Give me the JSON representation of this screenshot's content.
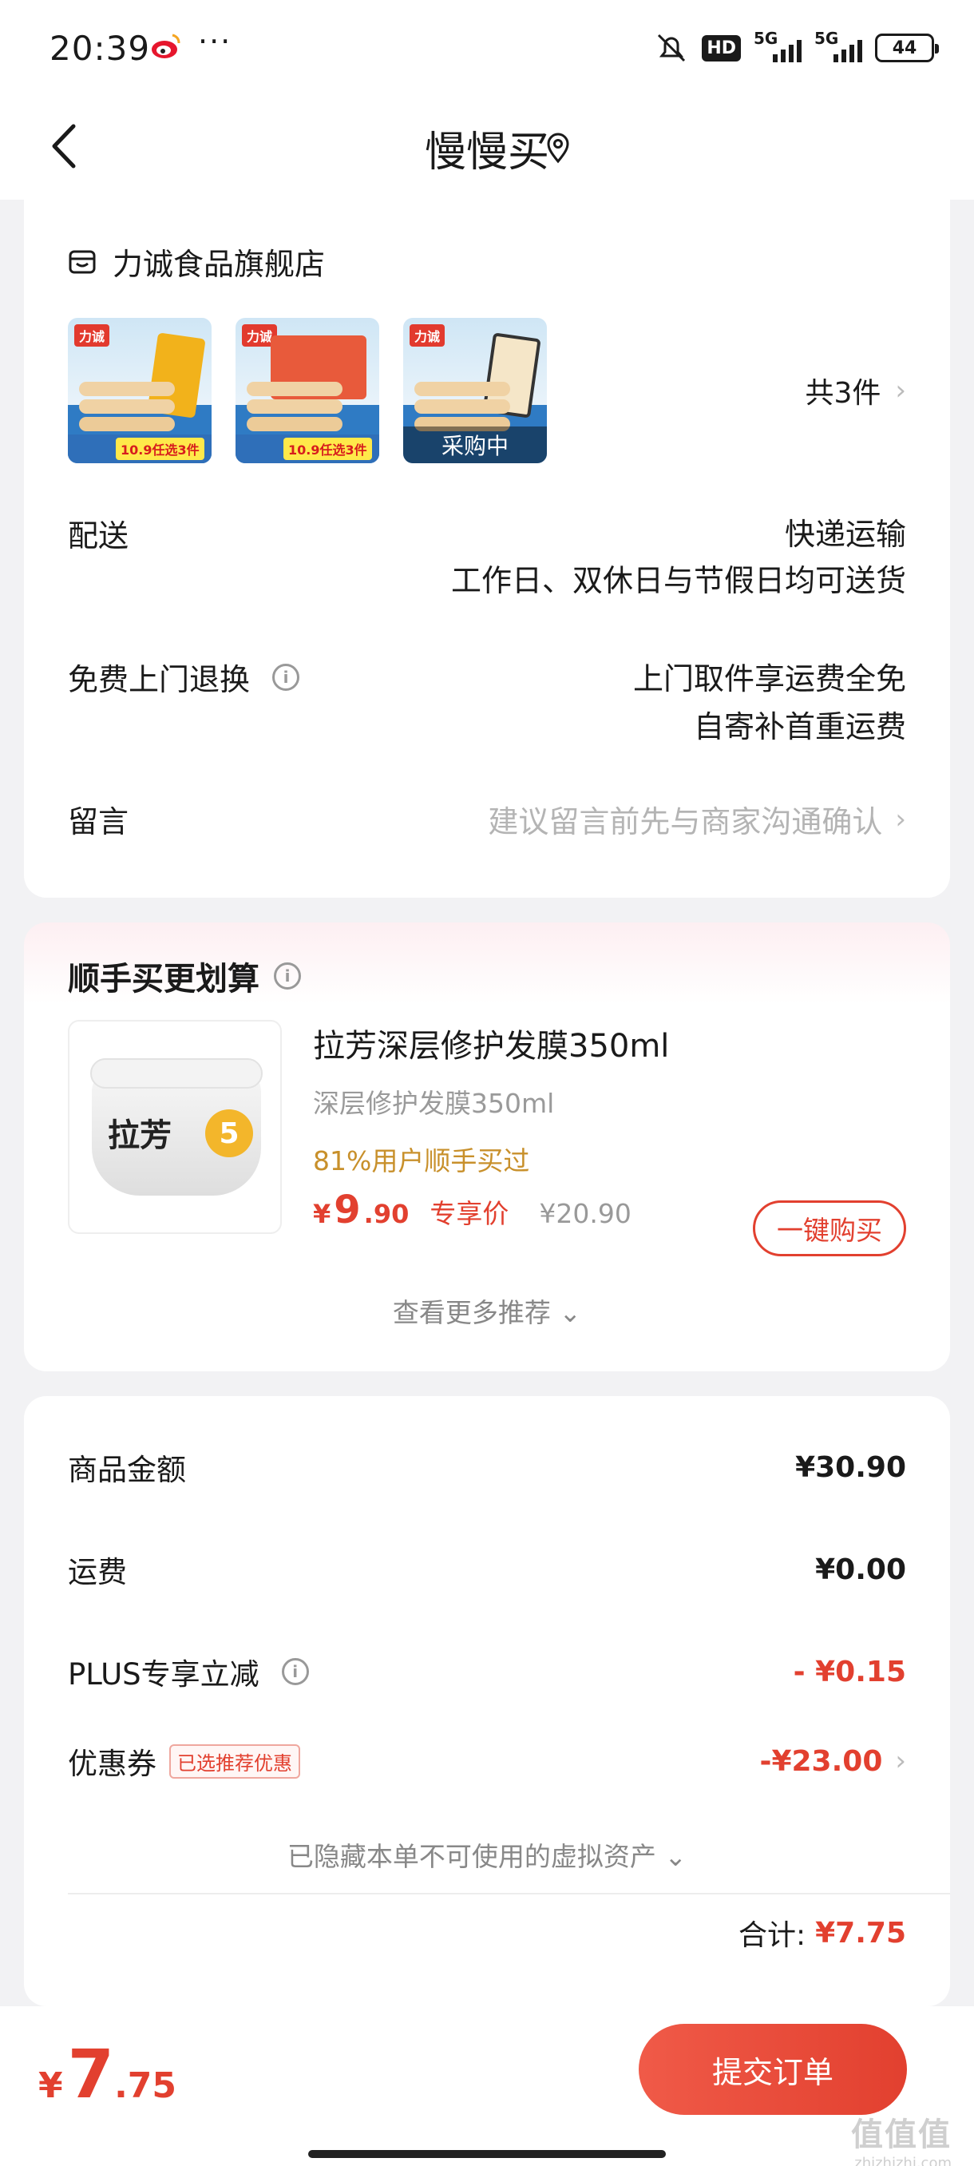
{
  "status_bar": {
    "time": "20:39",
    "dots": "···",
    "hd": "HD",
    "net1": "5G",
    "net2": "5G",
    "battery": "44"
  },
  "header": {
    "title": "慢慢买"
  },
  "store": {
    "name": "力诚食品旗舰店",
    "thumb_brand": "力诚",
    "thumb_price": "10.9任选3件",
    "thumb_overlay": "采购中",
    "count": "共3件",
    "delivery_label": "配送",
    "delivery_line1": "快递运输",
    "delivery_line2": "工作日、双休日与节假日均可送货",
    "return_label": "免费上门退换",
    "return_line1": "上门取件享运费全免",
    "return_line2": "自寄补首重运费",
    "message_label": "留言",
    "message_placeholder": "建议留言前先与商家沟通确认"
  },
  "recommend": {
    "title": "顺手买更划算",
    "product_name": "拉芳深层修护发膜350ml",
    "spec": "深层修护发膜350ml",
    "bought": "81%用户顺手买过",
    "price_symbol": "¥",
    "price_int": "9",
    "price_dec": ".90",
    "price_tag": "专享价",
    "orig_price": "¥20.90",
    "buy_label": "一键购买",
    "more": "查看更多推荐",
    "img_logo": "拉芳",
    "img_badge": "5"
  },
  "summary": {
    "goods_label": "商品金额",
    "goods_amount": "¥30.90",
    "shipping_label": "运费",
    "shipping_amount": "¥0.00",
    "plus_label": "PLUS专享立减",
    "plus_amount": "- ¥0.15",
    "coupon_label": "优惠券",
    "coupon_badge": "已选推荐优惠",
    "coupon_amount": "-¥23.00",
    "hidden_assets": "已隐藏本单不可使用的虚拟资产",
    "subtotal_label": "合计:",
    "subtotal_amount": "¥7.75"
  },
  "bottom": {
    "price_symbol": "¥",
    "price_int": "7",
    "price_dec": ".75",
    "submit_label": "提交订单",
    "watermark": "值值值",
    "watermark_site": "zhizhizhi.com"
  },
  "colors": {
    "accent": "#e2402f",
    "gold": "#c8902b",
    "bg": "#f2f2f4"
  }
}
